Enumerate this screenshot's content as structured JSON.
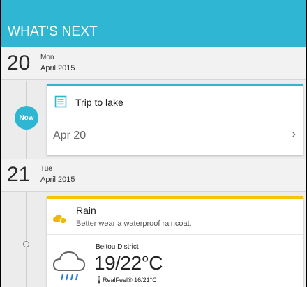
{
  "header": {
    "title": "WHAT'S NEXT"
  },
  "days": [
    {
      "num": "20",
      "weekday": "Mon",
      "month": "April 2015"
    },
    {
      "num": "21",
      "weekday": "Tue",
      "month": "April 2015"
    }
  ],
  "now_badge": "Now",
  "trip_card": {
    "title": "Trip to lake",
    "date": "Apr 20",
    "chevron": "›",
    "accent": "#2eb6d3"
  },
  "weather_card": {
    "title": "Rain",
    "subtitle": "Better wear a waterproof raincoat.",
    "district": "Beitou District",
    "temperature": "19/22°C",
    "realfeel": "RealFeel® 16/21°C",
    "accent": "#f5c400"
  },
  "colors": {
    "brand": "#2eb6d3",
    "weather_accent": "#f5c400"
  }
}
